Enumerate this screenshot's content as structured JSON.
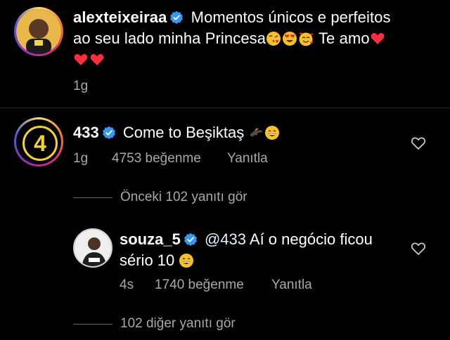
{
  "caption": {
    "username": "alexteixeiraa",
    "text_line1": "Momentos únicos e perfeitos",
    "text_line2": "ao seu lado minha Princesa",
    "text_after_emojis": "Te amo",
    "time": "1g"
  },
  "comment": {
    "username": "433",
    "avatar_text": "4",
    "text": "Come to Beşiktaş",
    "time": "1g",
    "likes": "4753 beğenme",
    "reply_label": "Yanıtla",
    "view_previous": "Önceki 102 yanıtı gör"
  },
  "reply": {
    "username": "souza_5",
    "mention": "@433",
    "text_part1": "Aí o negócio ficou",
    "text_part2": "sério 10",
    "time": "4s",
    "likes": "1740 beğenme",
    "reply_label": "Yanıtla",
    "view_more": "102 diğer yanıtı gör"
  },
  "colors": {
    "background": "#000000",
    "text": "#ffffff",
    "muted": "#a8a8a8",
    "verified": "#3897f0",
    "heart": "#ff2d3d",
    "ring_gradient": [
      "#feda75",
      "#fa7e1e",
      "#d62976",
      "#962fbf"
    ]
  },
  "icons": [
    "verified-badge-icon",
    "kiss-face-icon",
    "heart-eyes-icon",
    "smiling-hearts-icon",
    "red-heart-icon",
    "eagle-icon",
    "grin-face-icon",
    "like-heart-icon"
  ]
}
